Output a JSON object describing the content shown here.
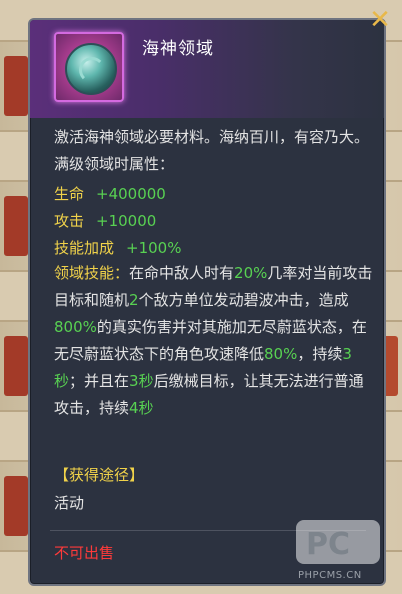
{
  "item": {
    "name": "海神领域",
    "icon": "sea-god-domain-orb-icon",
    "description": "激活海神领域必要材料。海纳百川，有容乃大。满级领域时属性："
  },
  "stats": [
    {
      "label": "生命",
      "value": "+400000"
    },
    {
      "label": "攻击",
      "value": "+10000"
    },
    {
      "label": "技能加成",
      "value": "+100%"
    }
  ],
  "skill": {
    "label": "领域技能：",
    "segments": [
      {
        "text": "在命中敌人时有",
        "color": "white"
      },
      {
        "text": "20%",
        "color": "green"
      },
      {
        "text": "几率对当前攻击目标和随机",
        "color": "white"
      },
      {
        "text": "2",
        "color": "green"
      },
      {
        "text": "个敌方单位发动碧波冲击，造成",
        "color": "white"
      },
      {
        "text": "800%",
        "color": "green"
      },
      {
        "text": "的真实伤害并对其施加无尽蔚蓝状态，在无尽蔚蓝状态下的角色攻速降低",
        "color": "white"
      },
      {
        "text": "80%",
        "color": "green"
      },
      {
        "text": "，持续",
        "color": "white"
      },
      {
        "text": "3秒",
        "color": "green"
      },
      {
        "text": "；并且在",
        "color": "white"
      },
      {
        "text": "3秒",
        "color": "green"
      },
      {
        "text": "后缴械目标，让其无法进行普通攻击，持续",
        "color": "white"
      },
      {
        "text": "4秒",
        "color": "green"
      }
    ]
  },
  "source": {
    "title": "【获得途径】",
    "value": "活动"
  },
  "sell_status": "不可出售",
  "watermark": {
    "logo": "PC",
    "site": "PHPCMS.CN"
  },
  "colors": {
    "label_yellow": "#f0d24a",
    "value_green": "#58d152",
    "warn_red": "#ff3a3a",
    "close_gold": "#e8b84a"
  }
}
